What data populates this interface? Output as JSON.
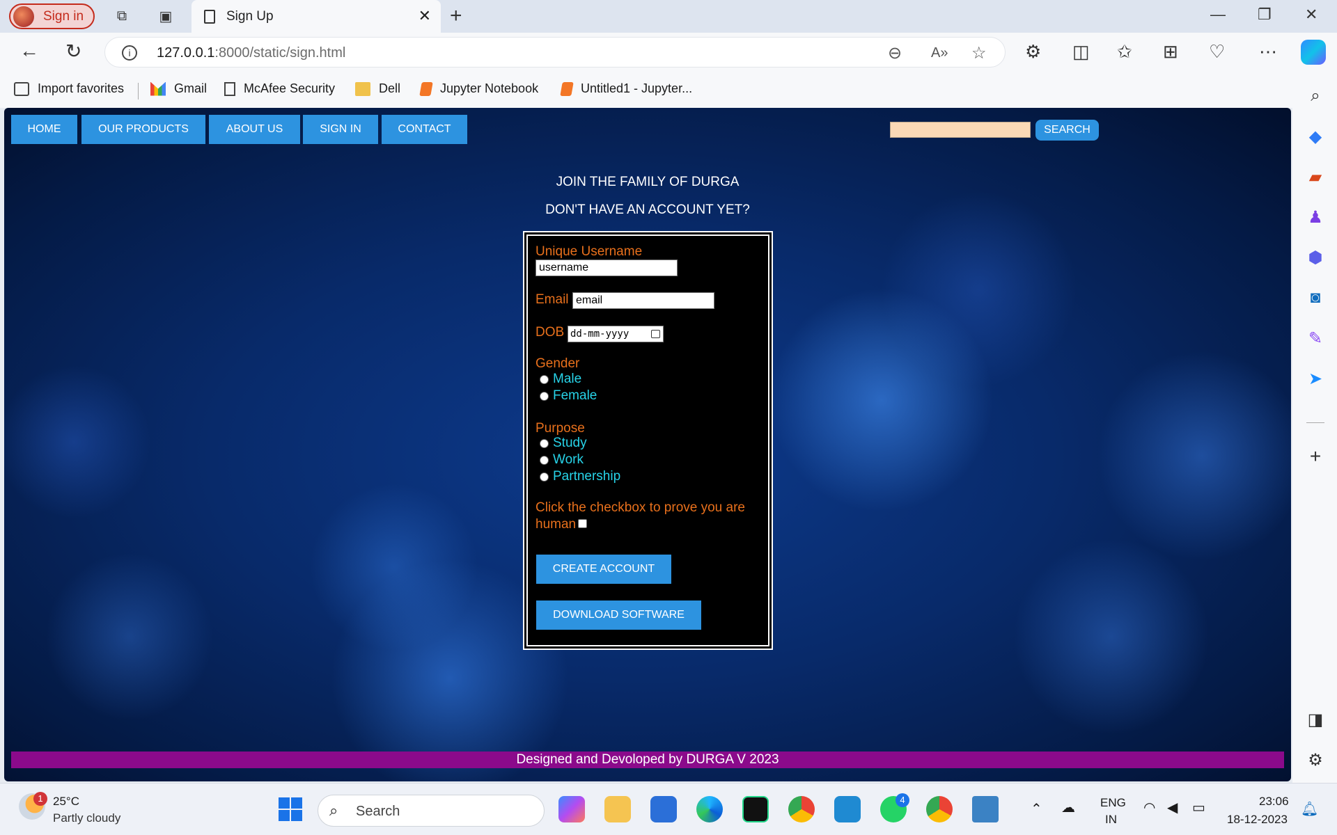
{
  "browser": {
    "profile_label": "Sign in",
    "tab_title": "Sign Up",
    "url_host": "127.0.0.1",
    "url_rest": ":8000/static/sign.html"
  },
  "favorites": [
    {
      "label": "Import favorites",
      "icon": "import-icon"
    },
    {
      "label": "Gmail",
      "icon": "gmail-icon"
    },
    {
      "label": "McAfee Security",
      "icon": "document-icon"
    },
    {
      "label": "Dell",
      "icon": "folder-icon"
    },
    {
      "label": "Jupyter Notebook",
      "icon": "jupyter-icon"
    },
    {
      "label": "Untitled1 - Jupyter...",
      "icon": "jupyter-icon"
    }
  ],
  "site": {
    "nav": [
      "HOME",
      "OUR PRODUCTS",
      "ABOUT US",
      "SIGN IN",
      "CONTACT"
    ],
    "search_value": "",
    "search_button": "SEARCH",
    "heading1": "JOIN THE FAMILY OF DURGA",
    "heading2": "DON'T HAVE AN ACCOUNT YET?",
    "form": {
      "username_label": "Unique Username",
      "username_value": "username",
      "email_label": "Email",
      "email_value": "email",
      "dob_label": "DOB",
      "dob_placeholder": "dd-mm-yyyy",
      "gender_label": "Gender",
      "gender_options": [
        "Male",
        "Female"
      ],
      "purpose_label": "Purpose",
      "purpose_options": [
        "Study",
        "Work",
        "Partnership"
      ],
      "human_text_line1": "Click the checkbox to prove you are",
      "human_text_line2": "human",
      "create_button": "CREATE ACCOUNT",
      "download_button": "DOWNLOAD SOFTWARE"
    },
    "footer": "Designed and Devoloped by DURGA V 2023"
  },
  "taskbar": {
    "weather_badge": "1",
    "temperature": "25°C",
    "weather_desc": "Partly cloudy",
    "search_placeholder": "Search",
    "whatsapp_badge": "4",
    "language_line1": "ENG",
    "language_line2": "IN",
    "time": "23:06",
    "date": "18-12-2023"
  },
  "colors": {
    "nav_button": "#2d93e0",
    "form_label": "#e8701c",
    "radio_label": "#27d3e8",
    "footer_bg": "#8b0a8b",
    "search_input_bg": "#fbd9b6"
  }
}
